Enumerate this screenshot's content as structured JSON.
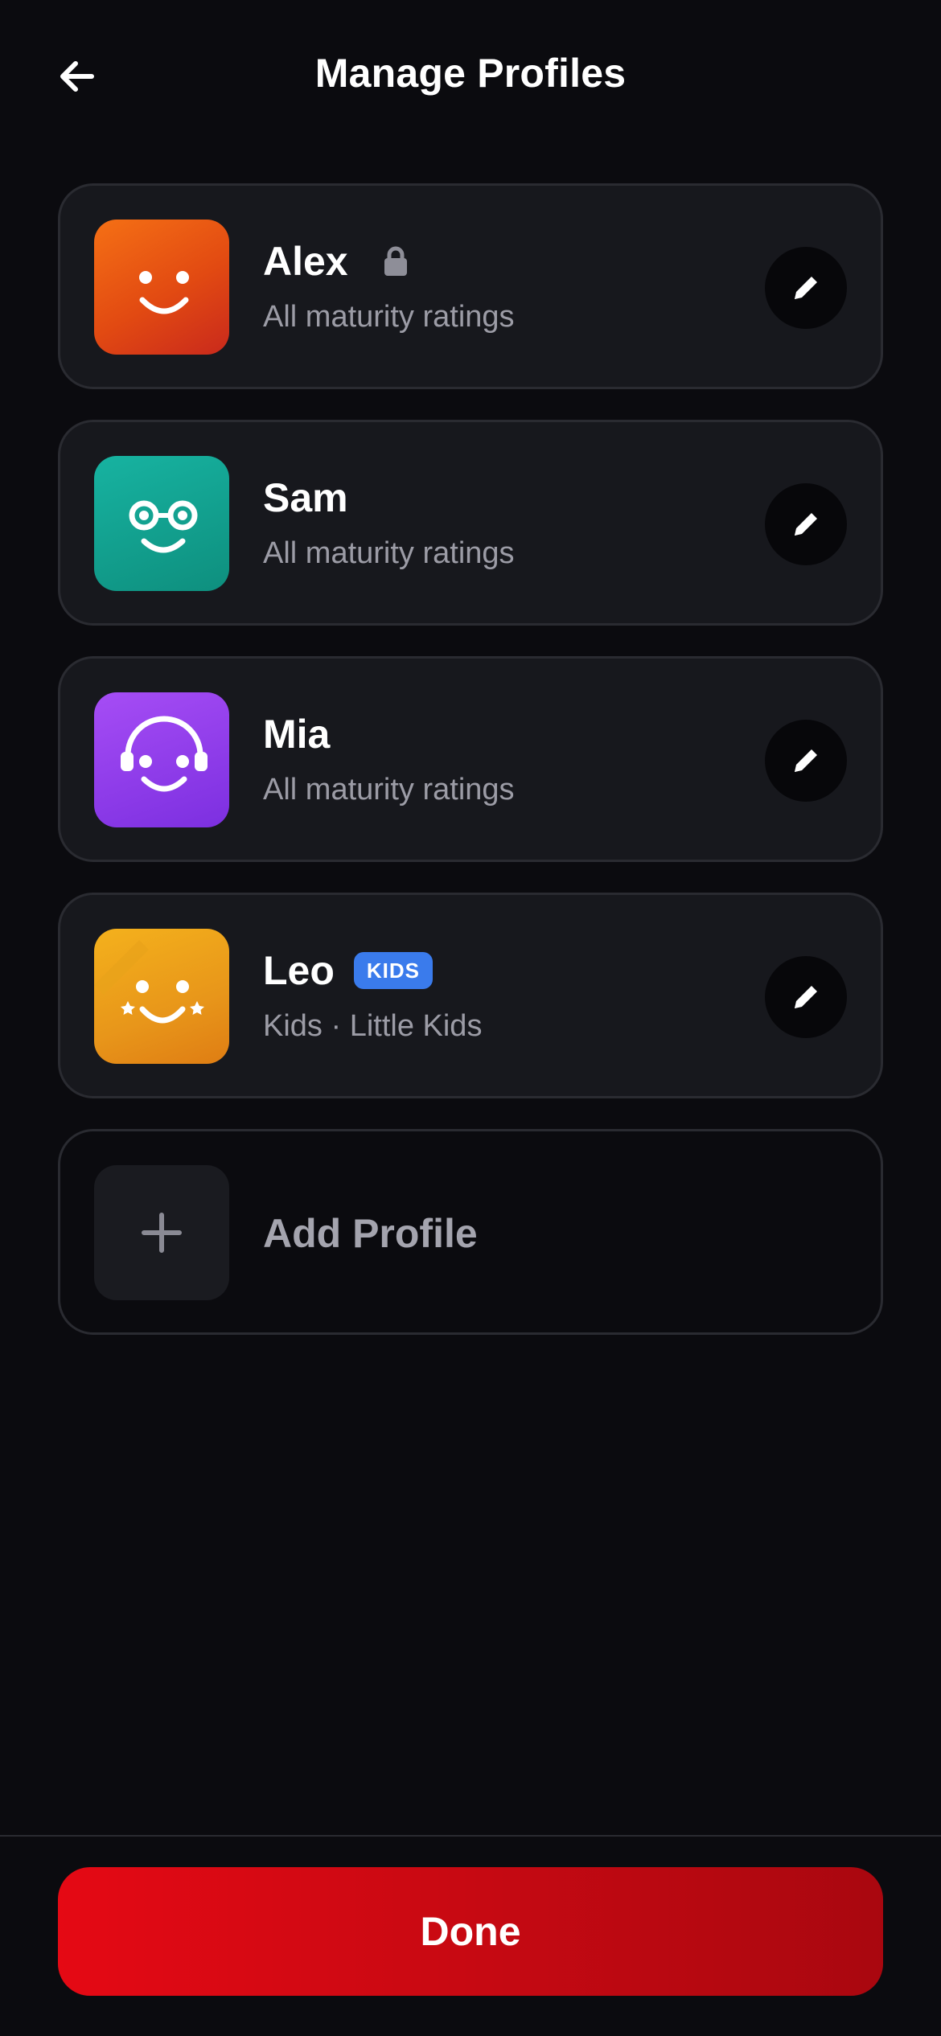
{
  "header": {
    "title": "Manage Profiles",
    "back_icon": "arrow-left-icon"
  },
  "profiles": [
    {
      "name": "Alex",
      "subtitle": "All maturity ratings",
      "avatar_color": "#e24a12",
      "avatar_icon": "smile-face-icon",
      "locked": true,
      "badge": null
    },
    {
      "name": "Sam",
      "subtitle": "All maturity ratings",
      "avatar_color": "#0e8f7e",
      "avatar_icon": "glasses-face-icon",
      "locked": false,
      "badge": null
    },
    {
      "name": "Mia",
      "subtitle": "All maturity ratings",
      "avatar_color": "#7c2fe0",
      "avatar_icon": "headphones-face-icon",
      "locked": false,
      "badge": null
    },
    {
      "name": "Leo",
      "subtitle": "Kids · Little Kids",
      "avatar_color": "#e8961a",
      "avatar_icon": "star-face-icon",
      "locked": false,
      "badge": "KIDS"
    }
  ],
  "add_profile": {
    "label": "Add Profile",
    "icon": "plus-icon"
  },
  "footer": {
    "done_label": "Done"
  },
  "colors": {
    "background": "#0b0b0f",
    "card": "#17181d",
    "accent": "#e50914",
    "kids_badge": "#3a7bec",
    "subtitle": "#9c9ca6"
  }
}
